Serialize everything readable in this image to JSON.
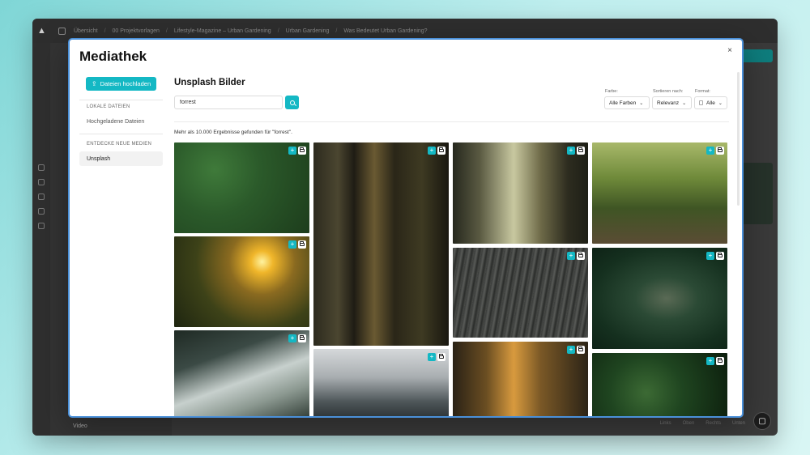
{
  "background_app": {
    "breadcrumbs": [
      "Übersicht",
      "00 Projektvorlagen",
      "Lifestyle-Magazine – Urban Gardening",
      "Urban Gardening",
      "Was Bedeutet Urban Gardening?"
    ],
    "bottom_item": "Video",
    "footer_links": [
      "Links",
      "Oben",
      "Rechts",
      "Unten"
    ]
  },
  "modal": {
    "title": "Mediathek",
    "close_label": "×",
    "upload_button": "Dateien hochladen",
    "sections": [
      {
        "heading": "LOKALE DATEIEN",
        "items": [
          {
            "label": "Hochgeladene Dateien",
            "active": false
          }
        ]
      },
      {
        "heading": "ENTDECKE NEUE MEDIEN",
        "items": [
          {
            "label": "Unsplash",
            "active": true
          }
        ]
      }
    ],
    "main": {
      "title": "Unsplash Bilder",
      "search_value": "forrest",
      "filters": [
        {
          "label": "Farbe:",
          "value": "Alle Farben"
        },
        {
          "label": "Sortieren nach:",
          "value": "Relevanz"
        },
        {
          "label": "Format:",
          "value": "Alle"
        }
      ],
      "results_text": "Mehr als 10.000 Ergebnisse gefunden für \"forrest\".",
      "tile_actions": {
        "add": "+",
        "folder": "folder-icon"
      }
    }
  },
  "colors": {
    "accent": "#14b8c4",
    "modal_border": "#4a90d9"
  }
}
